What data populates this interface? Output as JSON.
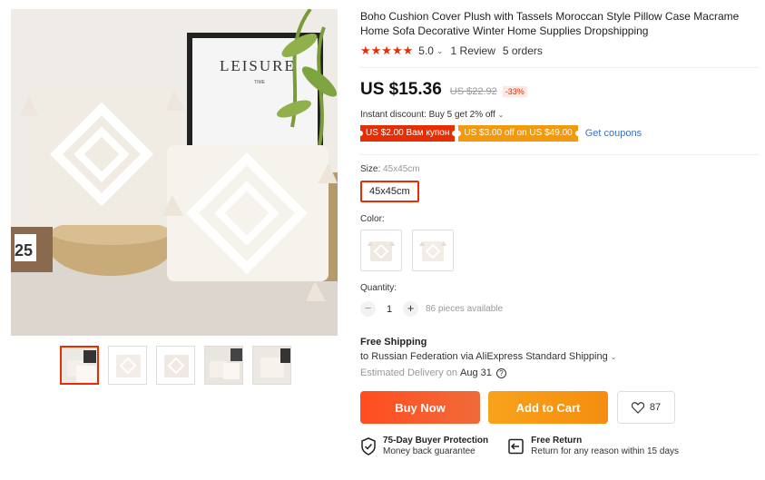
{
  "product": {
    "title": "Boho Cushion Cover Plush with Tassels Moroccan Style Pillow Case Macrame Home Sofa Decorative Winter Home Supplies Dropshipping",
    "rating_value": "5.0",
    "stars": "★★★★★",
    "reviews": "1 Review",
    "orders": "5 orders"
  },
  "gallery": {
    "poster_text": "LEISURE",
    "poster_subtext": "TIME",
    "calendar_number": "25"
  },
  "price": {
    "current": "US $15.36",
    "original": "US $22.92",
    "discount": "-33%"
  },
  "promo": {
    "instant": "Instant discount: Buy 5 get 2% off",
    "coupon1": "US $2.00 Вам купон",
    "coupon2": "US $3.00 off on US $49.00",
    "get_coupons": "Get coupons"
  },
  "size": {
    "label": "Size:",
    "selected": "45x45cm",
    "option": "45x45cm"
  },
  "color": {
    "label": "Color:"
  },
  "quantity": {
    "label": "Quantity:",
    "value": "1",
    "minus": "−",
    "plus": "+",
    "available": "86 pieces available"
  },
  "shipping": {
    "title": "Free Shipping",
    "destination": "to Russian Federation via AliExpress Standard Shipping",
    "delivery_label": "Estimated Delivery on",
    "delivery_date": "Aug 31",
    "help": "?"
  },
  "actions": {
    "buy_now": "Buy Now",
    "add_to_cart": "Add to Cart",
    "wishlist_count": "87"
  },
  "guarantees": [
    {
      "title": "75-Day Buyer Protection",
      "subtitle": "Money back guarantee",
      "icon": "shield-check-icon"
    },
    {
      "title": "Free Return",
      "subtitle": "Return for any reason within 15 days",
      "icon": "return-icon"
    }
  ],
  "colors": {
    "accent": "#e62e04",
    "buy": "#ff4d1f",
    "cart": "#f8a21b",
    "link": "#3a6ec7"
  }
}
